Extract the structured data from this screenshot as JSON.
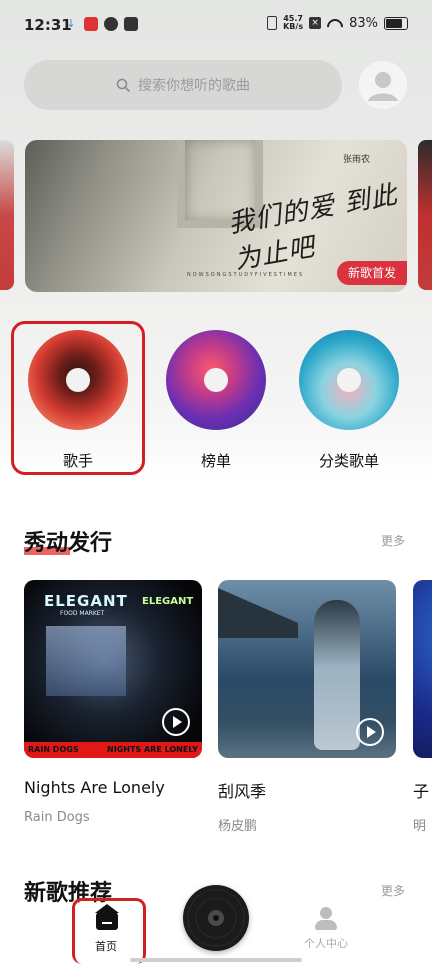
{
  "status_bar": {
    "time": "12:31",
    "net_speed_value": "45.7",
    "net_speed_unit": "KB/s",
    "battery": "83%"
  },
  "search": {
    "placeholder": "搜索你想听的歌曲"
  },
  "banner": {
    "artist": "张雨农",
    "title": "我们的爱 到此为止吧",
    "subtitle": "NOWSONGSTUDYFIVESTIMES",
    "tag": "新歌首发"
  },
  "categories": [
    {
      "label": "歌手",
      "color": "#d9403a"
    },
    {
      "label": "榜单",
      "color": "#6b2fb3"
    },
    {
      "label": "分类歌单",
      "color": "#2aa7c9"
    }
  ],
  "section_new": {
    "title": "秀动发行",
    "more": "更多",
    "cards": [
      {
        "title": "Nights Are Lonely",
        "artist": "Rain Dogs",
        "sign": "ELEGANT",
        "sign_sub": "FOOD MARKET",
        "strip_left": "RAIN DOGS",
        "strip_right": "NIGHTS ARE LONELY"
      },
      {
        "title": "刮风季",
        "artist": "杨皮鹏"
      },
      {
        "title": "子",
        "artist": "明"
      }
    ]
  },
  "section_recommend": {
    "title": "新歌推荐",
    "more": "更多"
  },
  "bottom_nav": {
    "home": "首页",
    "me": "个人中心"
  },
  "colors": {
    "accent_red": "#d9333f",
    "highlight_border": "#d11f23"
  }
}
